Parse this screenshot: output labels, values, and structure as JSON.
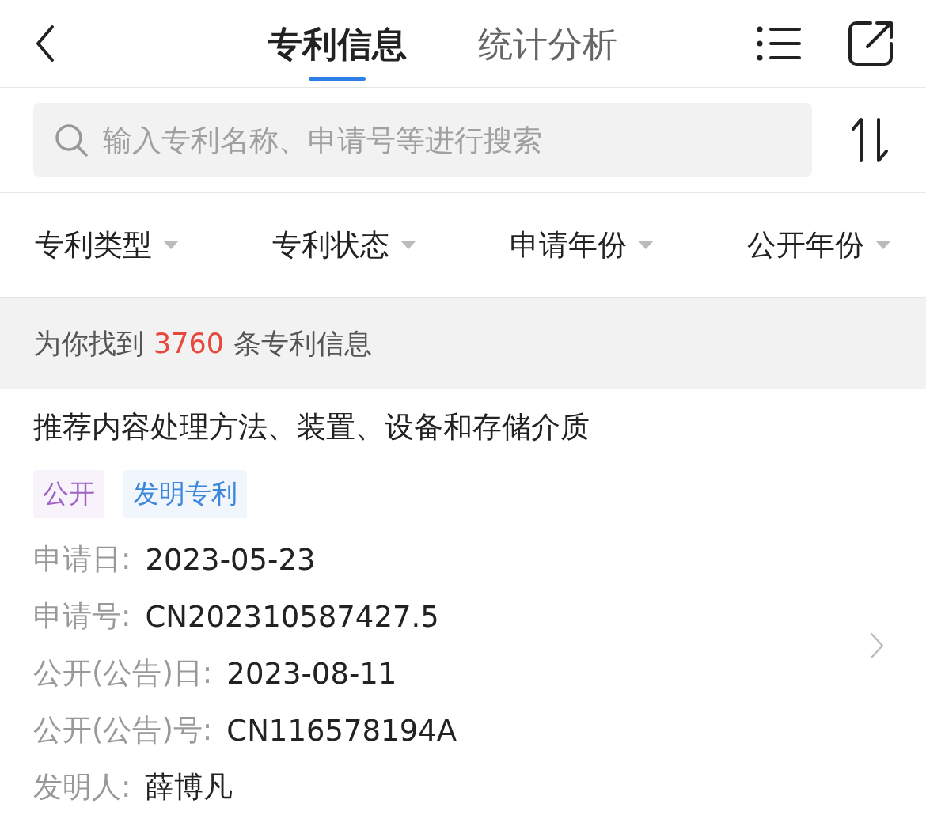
{
  "header": {
    "tabs": [
      {
        "label": "专利信息",
        "selected": true
      },
      {
        "label": "统计分析",
        "selected": false
      }
    ]
  },
  "search": {
    "placeholder": "输入专利名称、申请号等进行搜索"
  },
  "filters": [
    {
      "label": "专利类型"
    },
    {
      "label": "专利状态"
    },
    {
      "label": "申请年份"
    },
    {
      "label": "公开年份"
    }
  ],
  "result_count": {
    "prefix": "为你找到",
    "count": "3760",
    "suffix": "条专利信息"
  },
  "patents": [
    {
      "title": "推荐内容处理方法、装置、设备和存储介质",
      "tags": [
        {
          "label": "公开",
          "color": "#a064c8"
        },
        {
          "label": "发明专利",
          "color": "#3c87dc"
        }
      ],
      "fields": [
        {
          "label": "申请日:",
          "value": "2023-05-23"
        },
        {
          "label": "申请号:",
          "value": "CN202310587427.5"
        },
        {
          "label": "公开(公告)日:",
          "value": "2023-08-11"
        },
        {
          "label": "公开(公告)号:",
          "value": "CN116578194A"
        },
        {
          "label": "发明人:",
          "value": "薛博凡"
        }
      ]
    }
  ]
}
